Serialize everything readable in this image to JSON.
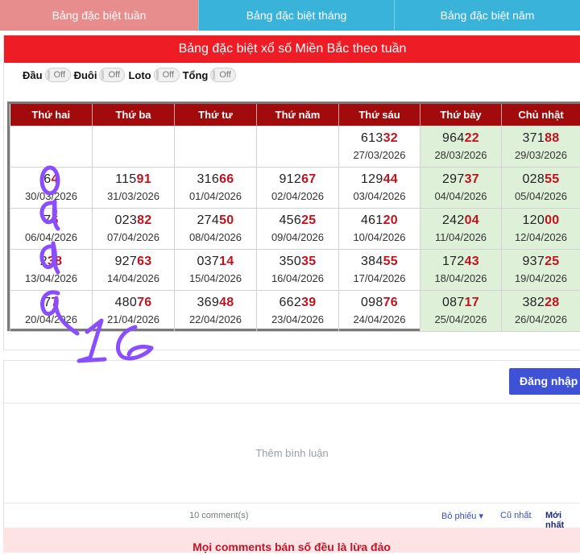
{
  "tabs": [
    {
      "label": "Bảng đặc biệt tuần"
    },
    {
      "label": "Bảng đặc biệt tháng"
    },
    {
      "label": "Bảng đặc biệt năm"
    }
  ],
  "panel": {
    "title": "Bảng đặc biệt xổ số Miền Bắc theo tuần"
  },
  "filters": [
    {
      "label": "Đầu",
      "state": "Off"
    },
    {
      "label": "Đuôi",
      "state": "Off"
    },
    {
      "label": "Loto",
      "state": "Off"
    },
    {
      "label": "Tổng",
      "state": "Off"
    }
  ],
  "table": {
    "headers": [
      "Thứ hai",
      "Thứ ba",
      "Thứ tư",
      "Thứ năm",
      "Thứ sáu",
      "Thứ bảy",
      "Chủ nhật"
    ],
    "rows": [
      [
        null,
        null,
        null,
        null,
        {
          "head": "613",
          "tail": "32",
          "date": "27/03/2026"
        },
        {
          "head": "964",
          "tail": "22",
          "date": "28/03/2026"
        },
        {
          "head": "371",
          "tail": "88",
          "date": "29/03/2026"
        }
      ],
      [
        {
          "head": "6",
          "tail": "4",
          "date": "30/03/2026"
        },
        {
          "head": "115",
          "tail": "91",
          "date": "31/03/2026"
        },
        {
          "head": "316",
          "tail": "66",
          "date": "01/04/2026"
        },
        {
          "head": "912",
          "tail": "67",
          "date": "02/04/2026"
        },
        {
          "head": "129",
          "tail": "44",
          "date": "03/04/2026"
        },
        {
          "head": "297",
          "tail": "37",
          "date": "04/04/2026"
        },
        {
          "head": "028",
          "tail": "55",
          "date": "05/04/2026"
        }
      ],
      [
        {
          "head": "7",
          "tail": "6",
          "date": "06/04/2026"
        },
        {
          "head": "023",
          "tail": "82",
          "date": "07/04/2026"
        },
        {
          "head": "274",
          "tail": "50",
          "date": "08/04/2026"
        },
        {
          "head": "456",
          "tail": "25",
          "date": "09/04/2026"
        },
        {
          "head": "461",
          "tail": "20",
          "date": "10/04/2026"
        },
        {
          "head": "242",
          "tail": "04",
          "date": "11/04/2026"
        },
        {
          "head": "120",
          "tail": "00",
          "date": "12/04/2026"
        }
      ],
      [
        {
          "head": "2",
          "tail": "38",
          "date": "13/04/2026"
        },
        {
          "head": "927",
          "tail": "63",
          "date": "14/04/2026"
        },
        {
          "head": "037",
          "tail": "14",
          "date": "15/04/2026"
        },
        {
          "head": "350",
          "tail": "35",
          "date": "16/04/2026"
        },
        {
          "head": "384",
          "tail": "55",
          "date": "17/04/2026"
        },
        {
          "head": "172",
          "tail": "43",
          "date": "18/04/2026"
        },
        {
          "head": "937",
          "tail": "25",
          "date": "19/04/2026"
        }
      ],
      [
        {
          "head": "7",
          "tail": "7",
          "date": "20/04/2026"
        },
        {
          "head": "480",
          "tail": "76",
          "date": "21/04/2026"
        },
        {
          "head": "369",
          "tail": "48",
          "date": "22/04/2026"
        },
        {
          "head": "662",
          "tail": "39",
          "date": "23/04/2026"
        },
        {
          "head": "098",
          "tail": "76",
          "date": "24/04/2026"
        },
        {
          "head": "087",
          "tail": "17",
          "date": "25/04/2026"
        },
        {
          "head": "382",
          "tail": "28",
          "date": "26/04/2026"
        }
      ]
    ]
  },
  "annotation": {
    "text": "0 d d d 16",
    "color": "#8a4dff"
  },
  "comments": {
    "login_label": "Đăng nhập",
    "placeholder": "Thêm bình luận",
    "count": "10 comment(s)",
    "vote_label": "Bỏ phiếu",
    "oldest_label": "Cũ nhất",
    "newest_label": "Mới nhất",
    "warning": "Mọi comments bán số đều là lừa đảo"
  },
  "colors": {
    "tab_active": "#e88d8d",
    "tab_inactive": "#39b3d9",
    "panel_header": "#ee1c25",
    "table_header": "#a10b0b",
    "weekend_bg": "#dff0d8",
    "tail_digits": "#c1121f",
    "login_button": "#3f51d4"
  }
}
